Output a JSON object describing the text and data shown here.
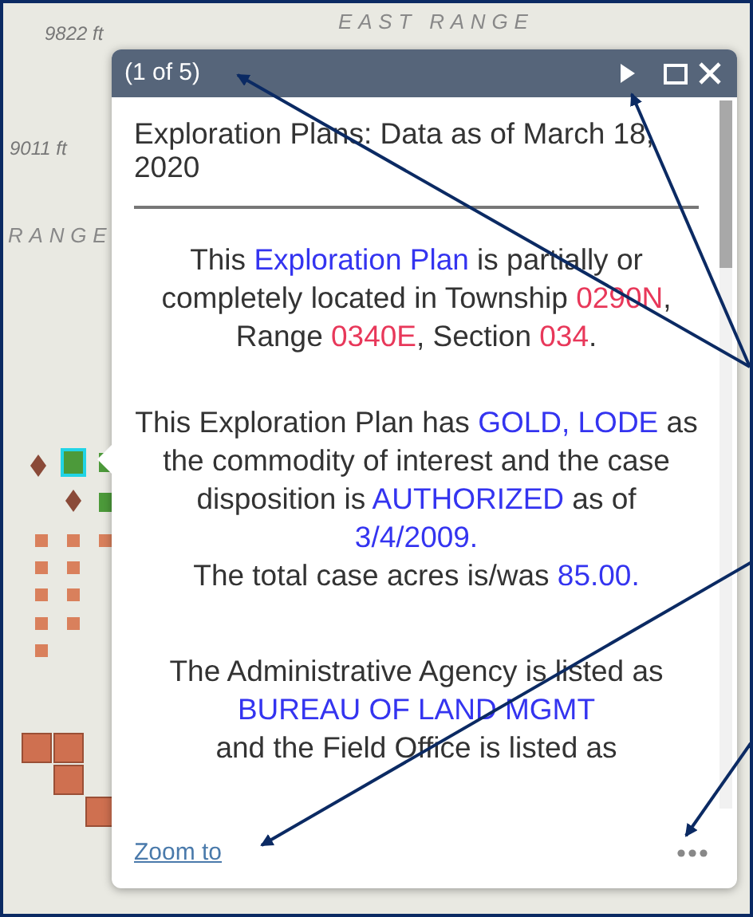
{
  "map": {
    "labels": [
      {
        "text": "EAST RANGE",
        "kind": "range"
      },
      {
        "text": "9822 ft",
        "kind": "elevation"
      },
      {
        "text": "9011 ft",
        "kind": "elevation"
      },
      {
        "text": "RANGE",
        "kind": "range"
      }
    ]
  },
  "popup": {
    "counter": "(1 of 5)",
    "title": "Exploration Plans: Data as of March 18, 2020",
    "paragraphs": [
      {
        "lines": [
          [
            {
              "text": "This ",
              "kind": "plain"
            },
            {
              "text": "Exploration Plan",
              "kind": "blue"
            },
            {
              "text": " is partially or completely located in Township ",
              "kind": "plain"
            },
            {
              "text": "0290N",
              "kind": "red"
            },
            {
              "text": ", Range ",
              "kind": "plain"
            },
            {
              "text": "0340E",
              "kind": "red"
            },
            {
              "text": ", Section ",
              "kind": "plain"
            },
            {
              "text": "034",
              "kind": "red"
            },
            {
              "text": ".",
              "kind": "plain"
            }
          ]
        ]
      },
      {
        "lines": [
          [
            {
              "text": "This Exploration Plan has ",
              "kind": "plain"
            },
            {
              "text": "GOLD, LODE",
              "kind": "blue"
            },
            {
              "text": " as the commodity of interest and the case disposition is ",
              "kind": "plain"
            },
            {
              "text": "AUTHORIZED",
              "kind": "blue"
            },
            {
              "text": " as of ",
              "kind": "plain"
            },
            {
              "text": "3/4/2009.",
              "kind": "blue"
            }
          ],
          [
            {
              "text": "The total case acres is/was ",
              "kind": "plain"
            },
            {
              "text": "85.00.",
              "kind": "blue"
            }
          ]
        ]
      },
      {
        "lines": [
          [
            {
              "text": "The Administrative Agency is listed as",
              "kind": "plain"
            }
          ],
          [
            {
              "text": "BUREAU OF LAND MGMT",
              "kind": "blue"
            }
          ],
          [
            {
              "text": "and the Field Office is listed as",
              "kind": "plain"
            }
          ]
        ]
      }
    ],
    "zoom_link": "Zoom to"
  }
}
